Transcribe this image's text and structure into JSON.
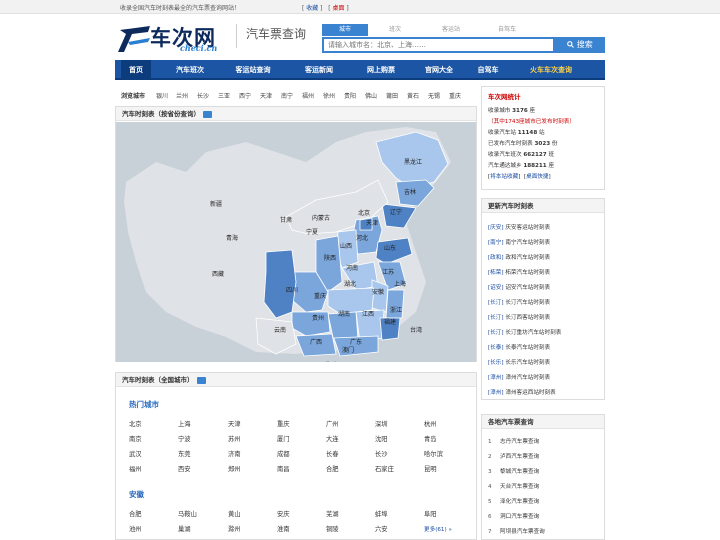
{
  "topbar": {
    "tagline": "收录全国汽车时刻表最全的汽车票查询网站！",
    "bookmark": "收藏",
    "desktop": "桌面"
  },
  "logo": {
    "cn": "车次网",
    "en": "checi.cn"
  },
  "site_sub": "汽车票查询",
  "search": {
    "tabs": [
      "城市",
      "班次",
      "客运站",
      "自驾车"
    ],
    "active_tab": 0,
    "placeholder": "请输入城市名：北京、上海……",
    "button": "搜索"
  },
  "nav": [
    "首页",
    "汽车班次",
    "客运站查询",
    "客运新闻",
    "网上购票",
    "官网大全",
    "自驾车",
    "火车车次查询"
  ],
  "citybar": {
    "label": "浏览城市",
    "cities": [
      "银川",
      "兰州",
      "长沙",
      "三亚",
      "西宁",
      "天津",
      "南宁",
      "福州",
      "徐州",
      "贵阳",
      "佛山",
      "莆田",
      "黄石",
      "无锡",
      "重庆"
    ]
  },
  "map": {
    "title": "汽车时刻表（按省份查询）",
    "provinces": [
      "黑龙江",
      "吉林",
      "辽宁",
      "内蒙古",
      "北京",
      "天津",
      "河北",
      "山西",
      "山东",
      "新疆",
      "青海",
      "甘肃",
      "宁夏",
      "陕西",
      "河南",
      "江苏",
      "上海",
      "西藏",
      "四川",
      "湖北",
      "安徽",
      "浙江",
      "重庆",
      "湖南",
      "江西",
      "贵州",
      "福建",
      "云南",
      "广西",
      "广东",
      "台湾",
      "澳门",
      "海南"
    ],
    "colors": {
      "sea": "#c8d0d8",
      "land": "#dfe2e6",
      "pale": "#a9c7ec",
      "mid": "#7aa6dc",
      "dark": "#4f82c4"
    }
  },
  "cities": {
    "title": "汽车时刻表（全国城市）",
    "groups": [
      {
        "name": "热门城市",
        "items": [
          "北京",
          "上海",
          "天津",
          "重庆",
          "广州",
          "深圳",
          "杭州",
          "南京",
          "宁波",
          "苏州",
          "厦门",
          "大连",
          "沈阳",
          "青岛",
          "武汉",
          "东莞",
          "济南",
          "成都",
          "长春",
          "长沙",
          "哈尔滨",
          "福州",
          "西安",
          "郑州",
          "南昌",
          "合肥",
          "石家庄",
          "昆明"
        ]
      },
      {
        "name": "安徽",
        "items": [
          "合肥",
          "马鞍山",
          "黄山",
          "安庆",
          "芜湖",
          "蚌埠",
          "阜阳",
          "池州",
          "巢湖",
          "滁州",
          "淮南",
          "铜陵",
          "六安"
        ],
        "more": "更多(61) »"
      }
    ]
  },
  "stats": {
    "title": "车次网统计",
    "lines": [
      {
        "pre": "收录城市 ",
        "val": "3176",
        "post": " 座"
      },
      {
        "pre": "（其中1743座城市已发布时刻表）",
        "val": "",
        "post": ""
      },
      {
        "pre": "收录汽车站 ",
        "val": "11148",
        "post": " 站"
      },
      {
        "pre": "已发布汽车时刻表 ",
        "val": "3023",
        "post": " 份"
      },
      {
        "pre": "收录汽车班次 ",
        "val": "662127",
        "post": " 班"
      },
      {
        "pre": "汽车通达城乡 ",
        "val": "188211",
        "post": " 座"
      }
    ],
    "bookmark": "将本站收藏",
    "shortcut": "桌面快捷"
  },
  "updates": {
    "title": "更新汽车时刻表",
    "items": [
      {
        "tag": "[庆安]",
        "text": "庆安客运站时刻表"
      },
      {
        "tag": "[南宁]",
        "text": "南宁汽车站时刻表"
      },
      {
        "tag": "[政和]",
        "text": "政和汽车站时刻表"
      },
      {
        "tag": "[柘荣]",
        "text": "柘荣汽车站时刻表"
      },
      {
        "tag": "[诏安]",
        "text": "诏安汽车站时刻表"
      },
      {
        "tag": "[长汀]",
        "text": "长汀汽车站时刻表"
      },
      {
        "tag": "[长汀]",
        "text": "长汀西客站时刻表"
      },
      {
        "tag": "[长汀]",
        "text": "长汀重坊汽车站时刻表"
      },
      {
        "tag": "[长泰]",
        "text": "长泰汽车站时刻表"
      },
      {
        "tag": "[长乐]",
        "text": "长乐汽车站时刻表"
      },
      {
        "tag": "[漳州]",
        "text": "漳州汽车站时刻表"
      },
      {
        "tag": "[漳州]",
        "text": "漳州客运西站时刻表"
      }
    ]
  },
  "ticket_query": {
    "title": "各地汽车票查询",
    "items": [
      "志丹汽车票查询",
      "泸西汽车票查询",
      "黎城汽车票查询",
      "天台汽车票查询",
      "泽化汽车票查询",
      "洞口汽车票查询",
      "阿坝县汽车票查询"
    ]
  }
}
